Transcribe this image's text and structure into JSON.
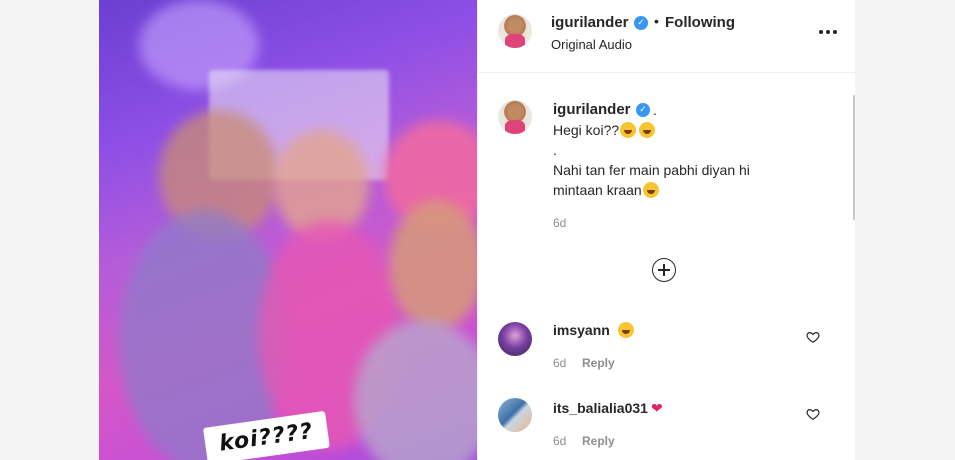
{
  "media": {
    "sticker_text": "koi????"
  },
  "post": {
    "author": "igurilander",
    "following_label": "Following",
    "audio_label": "Original Audio",
    "more_icon": "more-horizontal-icon"
  },
  "caption": {
    "author": "igurilander",
    "suffix": ".",
    "line1": "Hegi koi??",
    "line2": ".",
    "line3": "Nahi tan fer main pabhi diyan hi",
    "line4": "mintaan kraan",
    "time": "6d"
  },
  "load_more_icon": "plus-circle-icon",
  "comments": [
    {
      "username": "imsyann",
      "time": "6d",
      "reply_label": "Reply"
    },
    {
      "username": "its_balialia031",
      "time": "6d",
      "reply_label": "Reply"
    }
  ],
  "colors": {
    "verified": "#3897f0",
    "text": "#262626",
    "muted": "#8e8e8e",
    "heart": "#e0245e"
  }
}
